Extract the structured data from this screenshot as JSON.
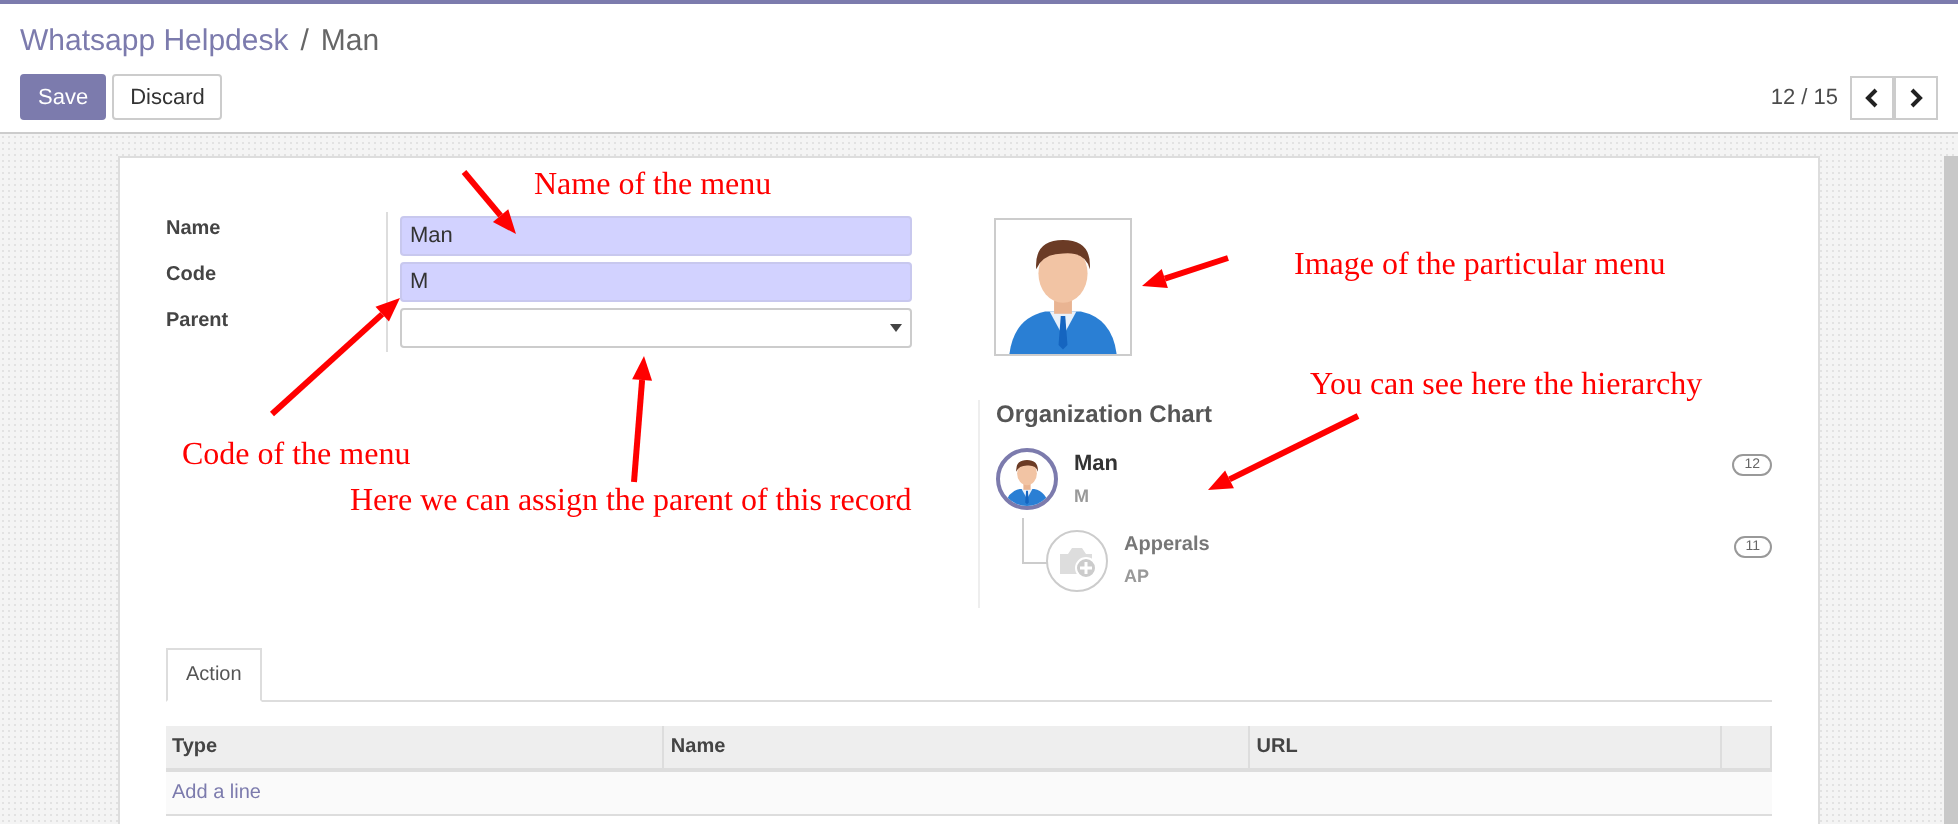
{
  "breadcrumb": [
    {
      "label": "Whatsapp Helpdesk",
      "kind": "link"
    },
    {
      "label": "Man",
      "kind": "current"
    }
  ],
  "buttons": [
    {
      "label": "Save",
      "kind": "primary"
    },
    {
      "label": "Discard",
      "kind": "secondary"
    }
  ],
  "breadcrumb_separator": "/",
  "pager": {
    "counter": "12 / 15"
  },
  "form": {
    "fields": [
      {
        "label": "Name",
        "kind": "text",
        "value": "Man",
        "required": true
      },
      {
        "label": "Code",
        "kind": "text",
        "value": "M",
        "required": true
      },
      {
        "label": "Parent",
        "kind": "select",
        "required": false
      }
    ]
  },
  "org_chart": {
    "title": "Organization Chart",
    "nodes": [
      {
        "name": "Man",
        "code": "M",
        "count": "12",
        "kind": "photo",
        "current": true,
        "children": [
          {
            "name": "Apperals",
            "code": "AP",
            "count": "11",
            "kind": "placeholder",
            "current": false
          }
        ]
      }
    ]
  },
  "tabs": [
    {
      "label": "Action",
      "selected": true
    }
  ],
  "table": {
    "columns": [
      "Type",
      "Name",
      "URL"
    ],
    "add_line": "Add a line"
  },
  "annotations": [
    {
      "text": "Name of the menu"
    },
    {
      "text": "Code of the menu"
    },
    {
      "text": "Here we can assign the parent of this record"
    },
    {
      "text": "Image of the particular menu"
    },
    {
      "text": "You can see here the hierarchy"
    }
  ]
}
